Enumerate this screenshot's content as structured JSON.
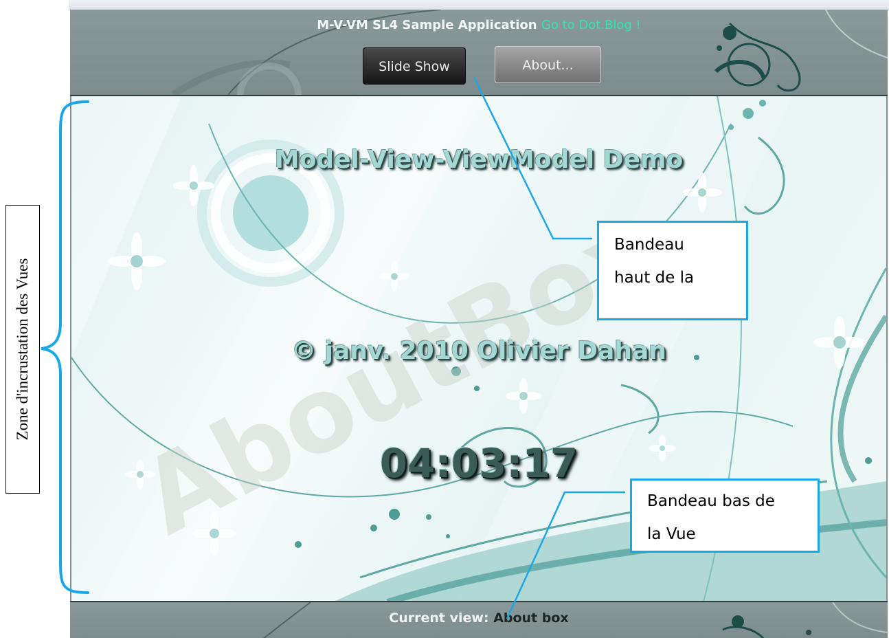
{
  "app": {
    "title": "M-V-VM SL4 Sample Application",
    "link_text": "Go to Dot.Blog !",
    "link_color": "#2ee6b4"
  },
  "nav": {
    "slideshow_label": "Slide Show",
    "about_label": "About..."
  },
  "view": {
    "title": "Model-View-ViewModel Demo",
    "copyright": "© janv. 2010 Olivier Dahan",
    "clock": "04:03:17",
    "watermark": "AboutBox"
  },
  "status": {
    "label": "Current view:",
    "value": "About box"
  },
  "annotations": {
    "zone_label": "Zone d'incrustation des Vues",
    "top_callout_line1": "Bandeau",
    "top_callout_line2": "haut de la",
    "bottom_callout_line1": "Bandeau bas de",
    "bottom_callout_line2": "la Vue",
    "callout_color": "#1aa7e8"
  },
  "colors": {
    "banner": "#7f9190",
    "view_text": "#a5d8d4",
    "clock": "#3b5b57"
  }
}
